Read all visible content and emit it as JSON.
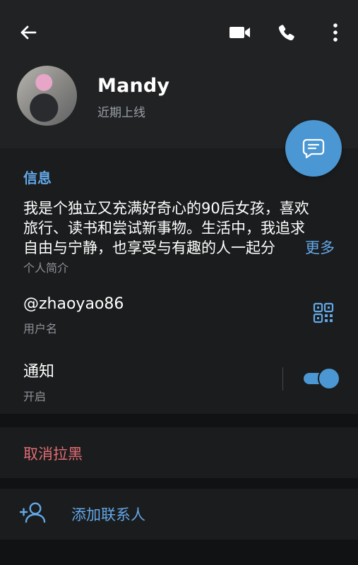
{
  "header": {
    "name": "Mandy",
    "status": "近期上线"
  },
  "icons": {
    "back": "arrow-left",
    "video": "video-camera",
    "phone": "phone",
    "more": "more-vertical",
    "message": "message-bubble",
    "qr": "qr-code",
    "add_contact": "person-add"
  },
  "info": {
    "title": "信息",
    "bio_lines": [
      "我是个独立又充满好奇心的90后女孩，喜欢",
      "旅行、读书和尝试新事物。生活中，我追求",
      "自由与宁静，也享受与有趣的人一起分"
    ],
    "more_label": "更多",
    "bio_label": "个人简介",
    "username": "@zhaoyao86",
    "username_label": "用户名",
    "notifications_label": "通知",
    "notifications_state": "开启",
    "notifications_on": true
  },
  "actions": {
    "unblock": "取消拉黑",
    "add_contact": "添加联系人"
  },
  "colors": {
    "accent": "#4b97d3",
    "link": "#62a8e8",
    "danger": "#e16d75"
  }
}
